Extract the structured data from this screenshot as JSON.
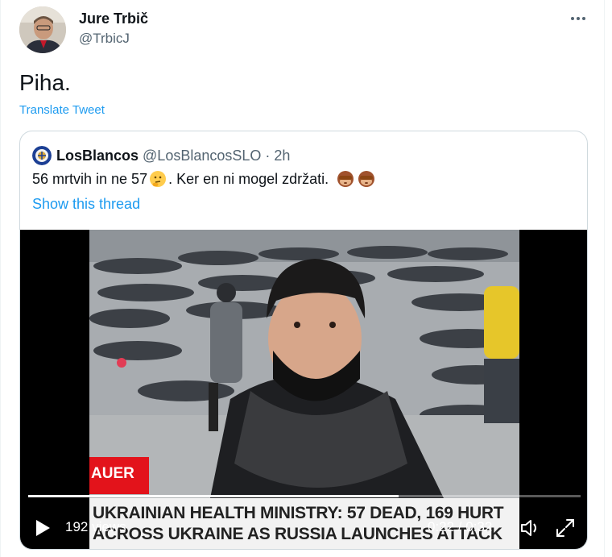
{
  "tweet": {
    "author_name": "Jure Trbič",
    "author_handle": "@TrbicJ",
    "text": "Piha.",
    "translate_label": "Translate Tweet",
    "more_icon": "more-dots-icon"
  },
  "quote": {
    "author_name": "LosBlancos",
    "author_handle": "@LosBlancosSLO",
    "separator": "·",
    "time": "2h",
    "text_part1": "56 mrtvih in ne 57",
    "text_part2": ". Ker en ni mogel zdržati.",
    "emojis": [
      "thinking-face-icon",
      "see-no-evil-monkey-icon",
      "see-no-evil-monkey-icon"
    ],
    "show_thread_label": "Show this thread"
  },
  "video": {
    "name_tag": "AUER",
    "caption_line1": "UKRAINIAN HEALTH MINISTRY: 57 DEAD, 169 HURT",
    "caption_line2": "ACROSS UKRAINE AS RUSSIA LAUNCHES ATTACK",
    "views": "192 views",
    "time": "0:22 / 0:32",
    "progress": 0.67
  },
  "colors": {
    "link": "#1d9bf0",
    "text": "#0f1419",
    "muted": "#536471",
    "border": "#cfd9de",
    "caption_red": "#e3131b"
  }
}
